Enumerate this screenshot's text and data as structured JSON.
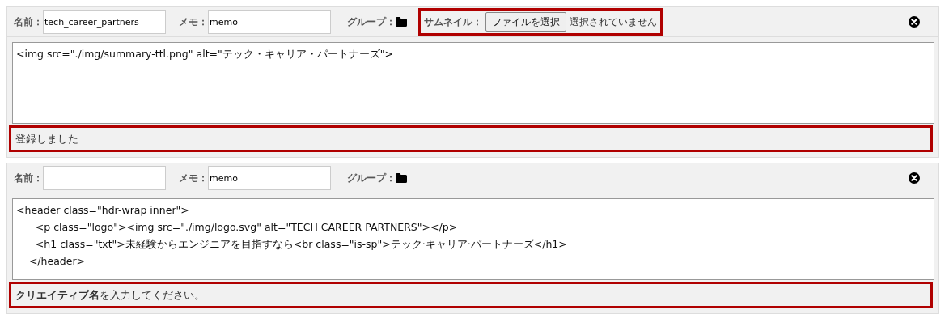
{
  "panels": [
    {
      "name_label": "名前：",
      "name_value": "tech_career_partners",
      "memo_label": "メモ：",
      "memo_value": "memo",
      "group_label": "グループ：",
      "thumbnail": {
        "label": "サムネイル：",
        "button": "ファイルを選択",
        "status": "選択されていません",
        "highlighted": true
      },
      "code_lines": [
        "<img src=\"./img/summary-ttl.png\" alt=\"テック・キャリア・パートナーズ\">"
      ],
      "message": "登録しました",
      "message_highlighted": true
    },
    {
      "name_label": "名前：",
      "memo_label": "メモ：",
      "memo_value": "memo",
      "group_label": "グループ：",
      "code_lines": [
        "<header class=\"hdr-wrap inner\">",
        "\t<p class=\"logo\"><img src=\"./img/logo.svg\" alt=\"TECH CAREER PARTNERS\"></p>",
        "\t<h1 class=\"txt\">未経験からエンジニアを目指すなら<br class=\"is-sp\">テック·キャリア·パートナーズ</h1>",
        "    </header>"
      ],
      "message": "**クリエイティブ名**を入力してください。",
      "message_highlighted": true
    }
  ]
}
